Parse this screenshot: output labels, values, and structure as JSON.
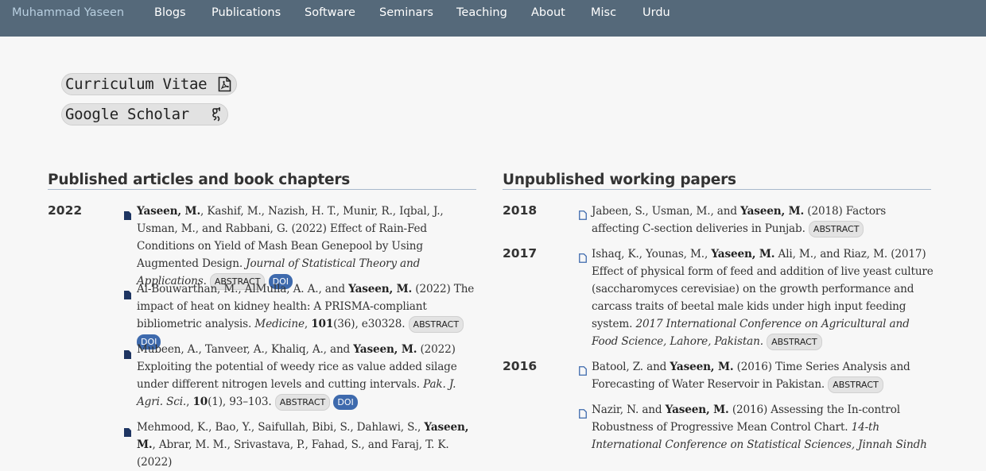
{
  "navbar": {
    "brand": "Muhammad Yaseen",
    "links": [
      "Blogs",
      "Publications",
      "Software",
      "Seminars",
      "Teaching",
      "About",
      "Misc",
      "Urdu"
    ]
  },
  "profile_links": [
    {
      "label": "Curriculum Vitae",
      "icon": "pdf-icon"
    },
    {
      "label": "Google Scholar",
      "icon": "google-scholar-icon"
    }
  ],
  "published": {
    "title": "Published articles and book chapters",
    "year": "2022",
    "abstract_label": "ABSTRACT",
    "doi_label": "DOI",
    "entries": [
      {
        "author_self": "Yaseen, M.",
        "authors_rest": ", Kashif, M., Nazish, H. T., Munir, R., Iqbal, J., Usman, M., and Rabbani, G. (2022) Effect of Rain-Fed Conditions on Yield of Mash Bean Genepool by Using Augmented Design.",
        "venue": "Journal of Statistical Theory and Applications"
      },
      {
        "authors_pre": "Al-Bouwarthan, M., AlMulla, A. A., and",
        "author_self": "Yaseen, M.",
        "title": " (2022) The impact of heat on kidney health: A PRISMA-compliant bibliometric analysis.",
        "venue": "Medicine",
        "volume": "101",
        "issue_pages": "(36), e30328."
      },
      {
        "authors_pre": "Mubeen, A., Tanveer, A., Khaliq, A., and",
        "author_self": "Yaseen, M.",
        "title": " (2022) Exploiting the potential of weedy rice as value added silage under different nitrogen levels and cutting intervals.",
        "venue": "Pak. J. Agri. Sci.",
        "volume": "10",
        "issue_pages": "(1), 93–103."
      },
      {
        "authors_pre": "Mehmood, K., Bao, Y., Saifullah, Bibi, S., Dahlawi, S.,",
        "author_self": "Yaseen, M.",
        "authors_rest": ", Abrar, M. M., Srivastava, P., Fahad, S., and Faraj, T. K. (2022)"
      }
    ]
  },
  "unpublished": {
    "title": "Unpublished working papers",
    "abstract_label": "ABSTRACT",
    "groups": [
      {
        "year": "2018",
        "entries": [
          {
            "authors_pre": "Jabeen, S., Usman, M., and",
            "author_self": "Yaseen, M.",
            "title": " (2018) Factors affecting C-section deliveries in Punjab."
          }
        ]
      },
      {
        "year": "2017",
        "entries": [
          {
            "authors_pre": "Ishaq, K., Younas, M.,",
            "author_self": "Yaseen, M.",
            "title": " Ali, M., and Riaz, M. (2017) Effect of physical form of feed and addition of live yeast culture (saccharomyces cerevisiae) on the growth performance and carcass traits of beetal male kids under high input feeding system.",
            "venue": " 2017 International Conference on Agricultural and Food Science, Lahore, Pakistan."
          }
        ]
      },
      {
        "year": "2016",
        "entries": [
          {
            "authors_pre": "Batool, Z. and",
            "author_self": "Yaseen, M.",
            "title": " (2016) Time Series Analysis and Forecasting of Water Reservoir in Pakistan."
          },
          {
            "authors_pre": "Nazir, N. and",
            "author_self": "Yaseen, M.",
            "title": " (2016) Assessing the In-control Robustness of Progressive Mean Control Chart.",
            "venue": " 14-th International Conference on Statistical Sciences, Jinnah Sindh"
          }
        ]
      }
    ]
  }
}
